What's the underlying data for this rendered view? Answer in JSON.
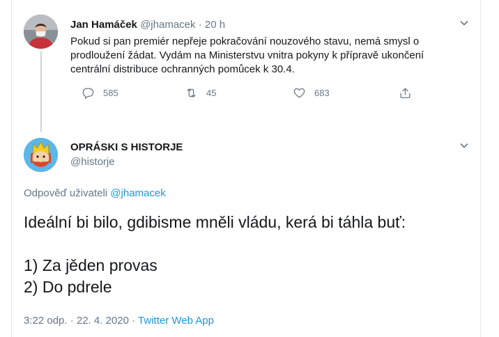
{
  "parent_tweet": {
    "name": "Jan Hamáček",
    "handle": "@jhamacek",
    "separator": "·",
    "time": "20 h",
    "text_lines": [
      "Pokud si pan premiér nepřeje pokračování nouzového stavu, nemá smysl o",
      "prodloužení žádat. Vydám na Ministerstvu vnitra pokyny k přípravě ukončení",
      "centrální distribuce ochranných pomůcek k 30.4."
    ],
    "actions": {
      "reply_count": "585",
      "retweet_count": "45",
      "like_count": "683"
    }
  },
  "main_tweet": {
    "name": "OPRÁSKI S HISTORJE",
    "handle": "@historje",
    "reply_prefix": "Odpověď uživateli",
    "reply_handle": "@jhamacek",
    "text_lines": [
      "Ideální bi bilo, gdibisme mněli vládu, kerá bi táhla buť:",
      "",
      "1) Za jěden provas",
      "2) Do pdrele"
    ],
    "timestamp": "3:22 odp. · 22. 4. 2020",
    "meta_separator": "·",
    "source": "Twitter Web App"
  },
  "icons": {
    "reply": "reply-icon",
    "retweet": "retweet-icon",
    "like": "heart-icon",
    "share": "share-icon",
    "menu": "chevron-down-icon"
  },
  "colors": {
    "link": "#1b95e0",
    "secondary_text": "#657786",
    "primary_text": "#14171a",
    "thread_line": "#ccd6dd"
  }
}
